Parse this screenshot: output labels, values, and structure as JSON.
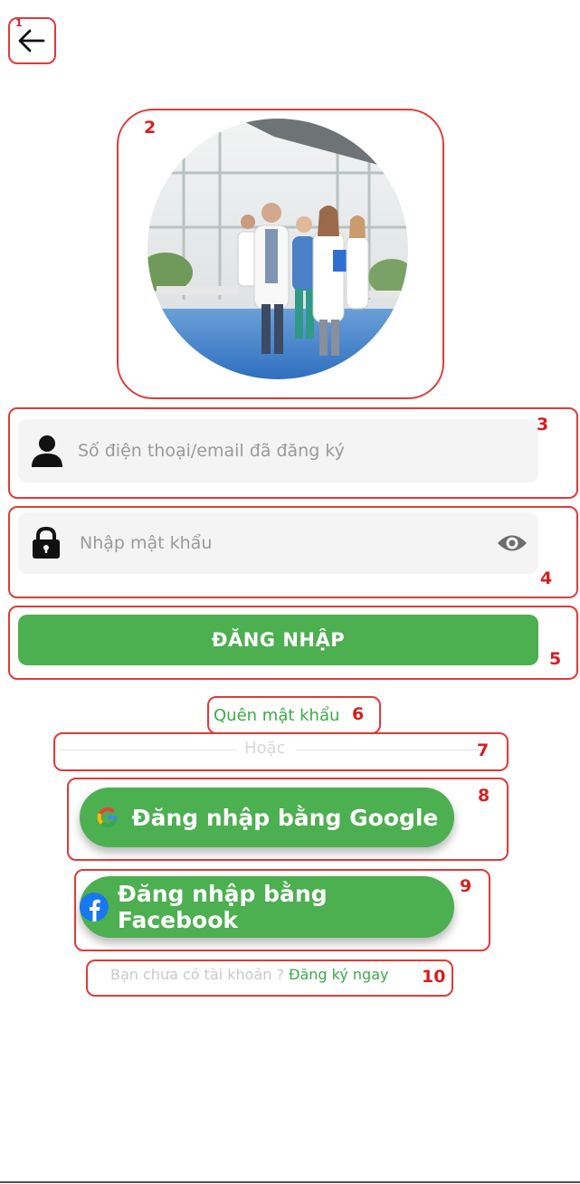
{
  "annotations": [
    "1",
    "2",
    "3",
    "4",
    "5",
    "6",
    "7",
    "8",
    "9",
    "10"
  ],
  "login": {
    "phone_placeholder": "Số điện thoại/email đã đăng ký",
    "password_placeholder": "Nhập mật khẩu",
    "login_button": "ĐĂNG NHẬP",
    "forgot_password": "Quên mật khẩu",
    "or_label": "Hoặc",
    "google_button": "Đăng nhập bằng Google",
    "facebook_button": "Đăng nhập bằng Facebook",
    "signup_prompt": "Bạn chưa có tài khoản ?",
    "signup_link": "Đăng ký ngay"
  },
  "icons": {
    "back": "arrow-left-icon",
    "user": "user-icon",
    "lock": "lock-icon",
    "eye": "eye-icon",
    "google": "google-icon",
    "facebook": "facebook-icon"
  },
  "colors": {
    "primary_green": "#4caf50",
    "link_green": "#3daa48",
    "field_bg": "#f4f4f4",
    "annotation_red": "#e03a3a"
  }
}
